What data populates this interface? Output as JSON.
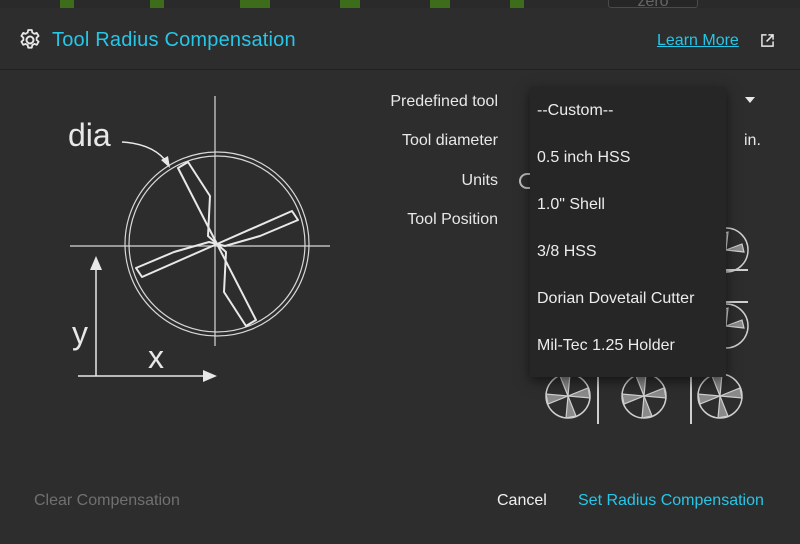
{
  "background": {
    "zero_label": "zero"
  },
  "header": {
    "title": "Tool Radius Compensation",
    "learn_more": "Learn More"
  },
  "diagram": {
    "label_dia": "dia",
    "label_x": "x",
    "label_y": "y"
  },
  "form": {
    "predefined_tool_label": "Predefined tool",
    "tool_diameter_label": "Tool diameter",
    "units_label": "Units",
    "tool_position_label": "Tool Position",
    "diameter_unit": "in."
  },
  "dropdown": {
    "options": [
      "--Custom--",
      "0.5 inch HSS",
      "1.0\" Shell",
      "3/8 HSS",
      "Dorian Dovetail Cutter",
      "Mil-Tec 1.25 Holder"
    ]
  },
  "footer": {
    "clear": "Clear Compensation",
    "cancel": "Cancel",
    "set": "Set Radius Compensation"
  },
  "colors": {
    "accent": "#26c6e8",
    "dialog_bg": "#2d2d2d",
    "dropdown_bg": "#262626",
    "disabled_text": "#707070"
  }
}
